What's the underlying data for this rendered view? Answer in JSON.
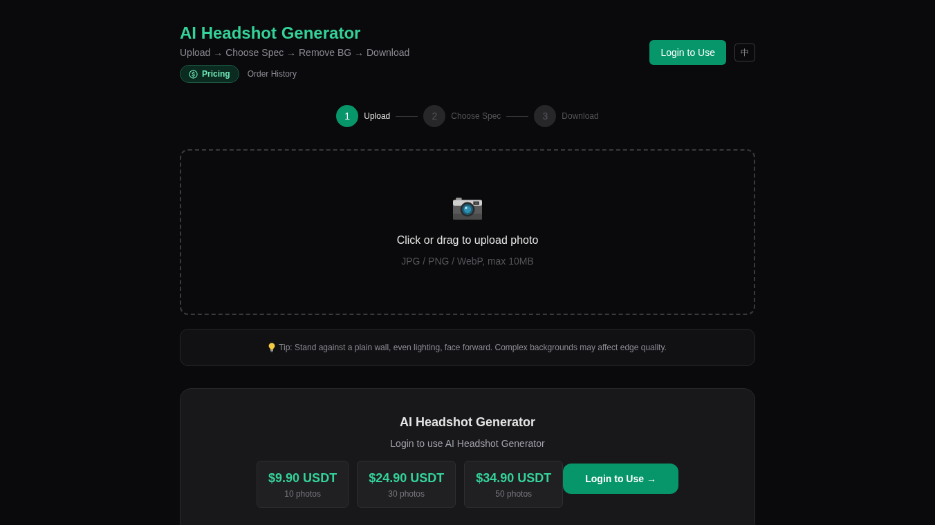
{
  "header": {
    "title": "AI Headshot Generator",
    "subtitle": "Upload → Choose Spec → Remove BG → Download",
    "links": [
      {
        "label": "Pricing",
        "kind": "pill"
      },
      {
        "label": "Order History",
        "kind": "link"
      }
    ],
    "login_button": "Login to Use",
    "language_button": "中"
  },
  "steps": [
    {
      "number": "1",
      "label": "Upload",
      "selected": true
    },
    {
      "number": "2",
      "label": "Choose Spec",
      "selected": false
    },
    {
      "number": "3",
      "label": "Download",
      "selected": false
    }
  ],
  "upload": {
    "title": "Click or drag to upload photo",
    "hint": "JPG / PNG / WebP, max 10MB"
  },
  "tip": {
    "text": "Tip: Stand against a plain wall, even lighting, face forward. Complex backgrounds may affect edge quality."
  },
  "login_card": {
    "title": "AI Headshot Generator",
    "subtitle": "Login to use AI Headshot Generator",
    "plans": [
      {
        "price": "$9.90 USDT",
        "photos": "10 photos"
      },
      {
        "price": "$24.90 USDT",
        "photos": "30 photos"
      },
      {
        "price": "$34.90 USDT",
        "photos": "50 photos"
      }
    ],
    "button": "Login to Use →"
  }
}
